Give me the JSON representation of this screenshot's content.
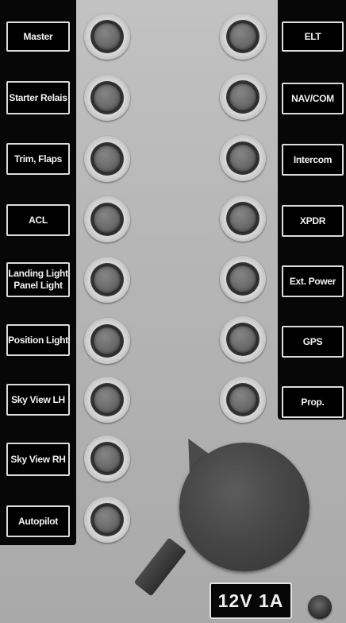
{
  "left_breakers": [
    {
      "label": "Master"
    },
    {
      "label": "Starter Relais"
    },
    {
      "label": "Trim, Flaps"
    },
    {
      "label": "ACL"
    },
    {
      "label": "Landing Light\nPanel Light"
    },
    {
      "label": "Position Light"
    },
    {
      "label": "Sky View LH"
    },
    {
      "label": "Sky View RH"
    },
    {
      "label": "Autopilot"
    }
  ],
  "right_breakers": [
    {
      "label": "ELT"
    },
    {
      "label": "NAV/COM"
    },
    {
      "label": "Intercom"
    },
    {
      "label": "XPDR"
    },
    {
      "label": "Ext. Power"
    },
    {
      "label": "GPS"
    },
    {
      "label": "Prop."
    }
  ],
  "power_outlet": {
    "rating": "12V 1A"
  },
  "icons": {
    "breaker": "circuit-breaker-icon",
    "knob": "rotary-knob-icon",
    "led": "indicator-led-icon"
  },
  "colors": {
    "panel": "#b4b4b4",
    "label_bg": "#000000",
    "label_text": "#f2f2f2",
    "label_border": "#dcdcdc"
  }
}
